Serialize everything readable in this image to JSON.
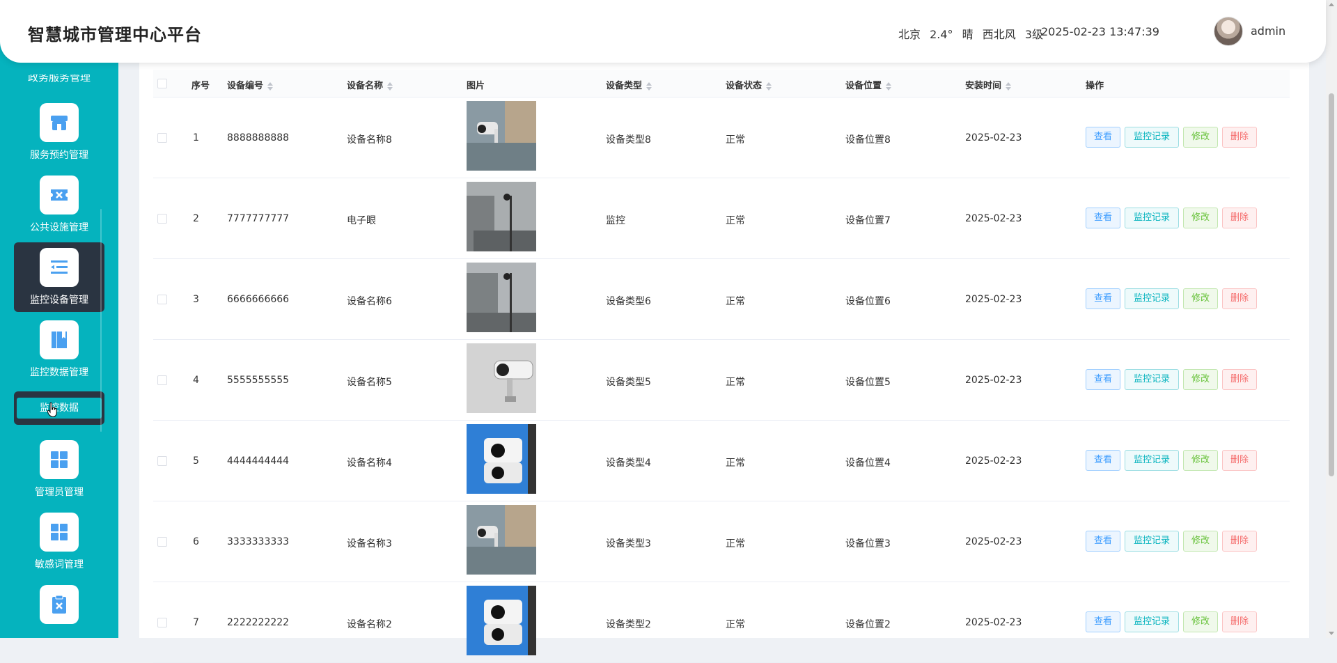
{
  "header": {
    "title": "智慧城市管理中心平台",
    "weather_city": "北京",
    "weather_temp": "2.4°",
    "weather_cond": "晴",
    "weather_wind": "西北风",
    "weather_level": "3级",
    "datetime": "2025-02-23 13:47:39",
    "username": "admin"
  },
  "sidebar": {
    "cut_label": "政务服务管理",
    "items": [
      {
        "label": "服务预约管理",
        "icon": "store-icon"
      },
      {
        "label": "公共设施管理",
        "icon": "ticket-icon"
      },
      {
        "label": "监控设备管理",
        "icon": "list-icon"
      },
      {
        "label": "监控数据管理",
        "icon": "book-icon"
      },
      {
        "label": "管理员管理",
        "icon": "grid-icon"
      },
      {
        "label": "敏感词管理",
        "icon": "grid-icon"
      },
      {
        "label": "",
        "icon": "clipboard-icon"
      }
    ],
    "submenu_active": "监控数据"
  },
  "table": {
    "columns": [
      "序号",
      "设备编号",
      "设备名称",
      "图片",
      "设备类型",
      "设备状态",
      "设备位置",
      "安装时间",
      "操作"
    ],
    "actions": {
      "view": "查看",
      "log": "监控记录",
      "edit": "修改",
      "delete": "删除"
    },
    "rows": [
      {
        "no": "1",
        "code": "8888888888",
        "name": "设备名称8",
        "type": "设备类型8",
        "status": "正常",
        "location": "设备位置8",
        "date": "2025-02-23"
      },
      {
        "no": "2",
        "code": "7777777777",
        "name": "电子眼",
        "type": "监控",
        "status": "正常",
        "location": "设备位置7",
        "date": "2025-02-23"
      },
      {
        "no": "3",
        "code": "6666666666",
        "name": "设备名称6",
        "type": "设备类型6",
        "status": "正常",
        "location": "设备位置6",
        "date": "2025-02-23"
      },
      {
        "no": "4",
        "code": "5555555555",
        "name": "设备名称5",
        "type": "设备类型5",
        "status": "正常",
        "location": "设备位置5",
        "date": "2025-02-23"
      },
      {
        "no": "5",
        "code": "4444444444",
        "name": "设备名称4",
        "type": "设备类型4",
        "status": "正常",
        "location": "设备位置4",
        "date": "2025-02-23"
      },
      {
        "no": "6",
        "code": "3333333333",
        "name": "设备名称3",
        "type": "设备类型3",
        "status": "正常",
        "location": "设备位置3",
        "date": "2025-02-23"
      },
      {
        "no": "7",
        "code": "2222222222",
        "name": "设备名称2",
        "type": "设备类型2",
        "status": "正常",
        "location": "设备位置2",
        "date": "2025-02-23"
      }
    ]
  },
  "colors": {
    "sidebar": "#05b3be",
    "active": "#2a3441",
    "view": "#409eff",
    "edit": "#67c23a",
    "delete": "#f56c6c"
  }
}
